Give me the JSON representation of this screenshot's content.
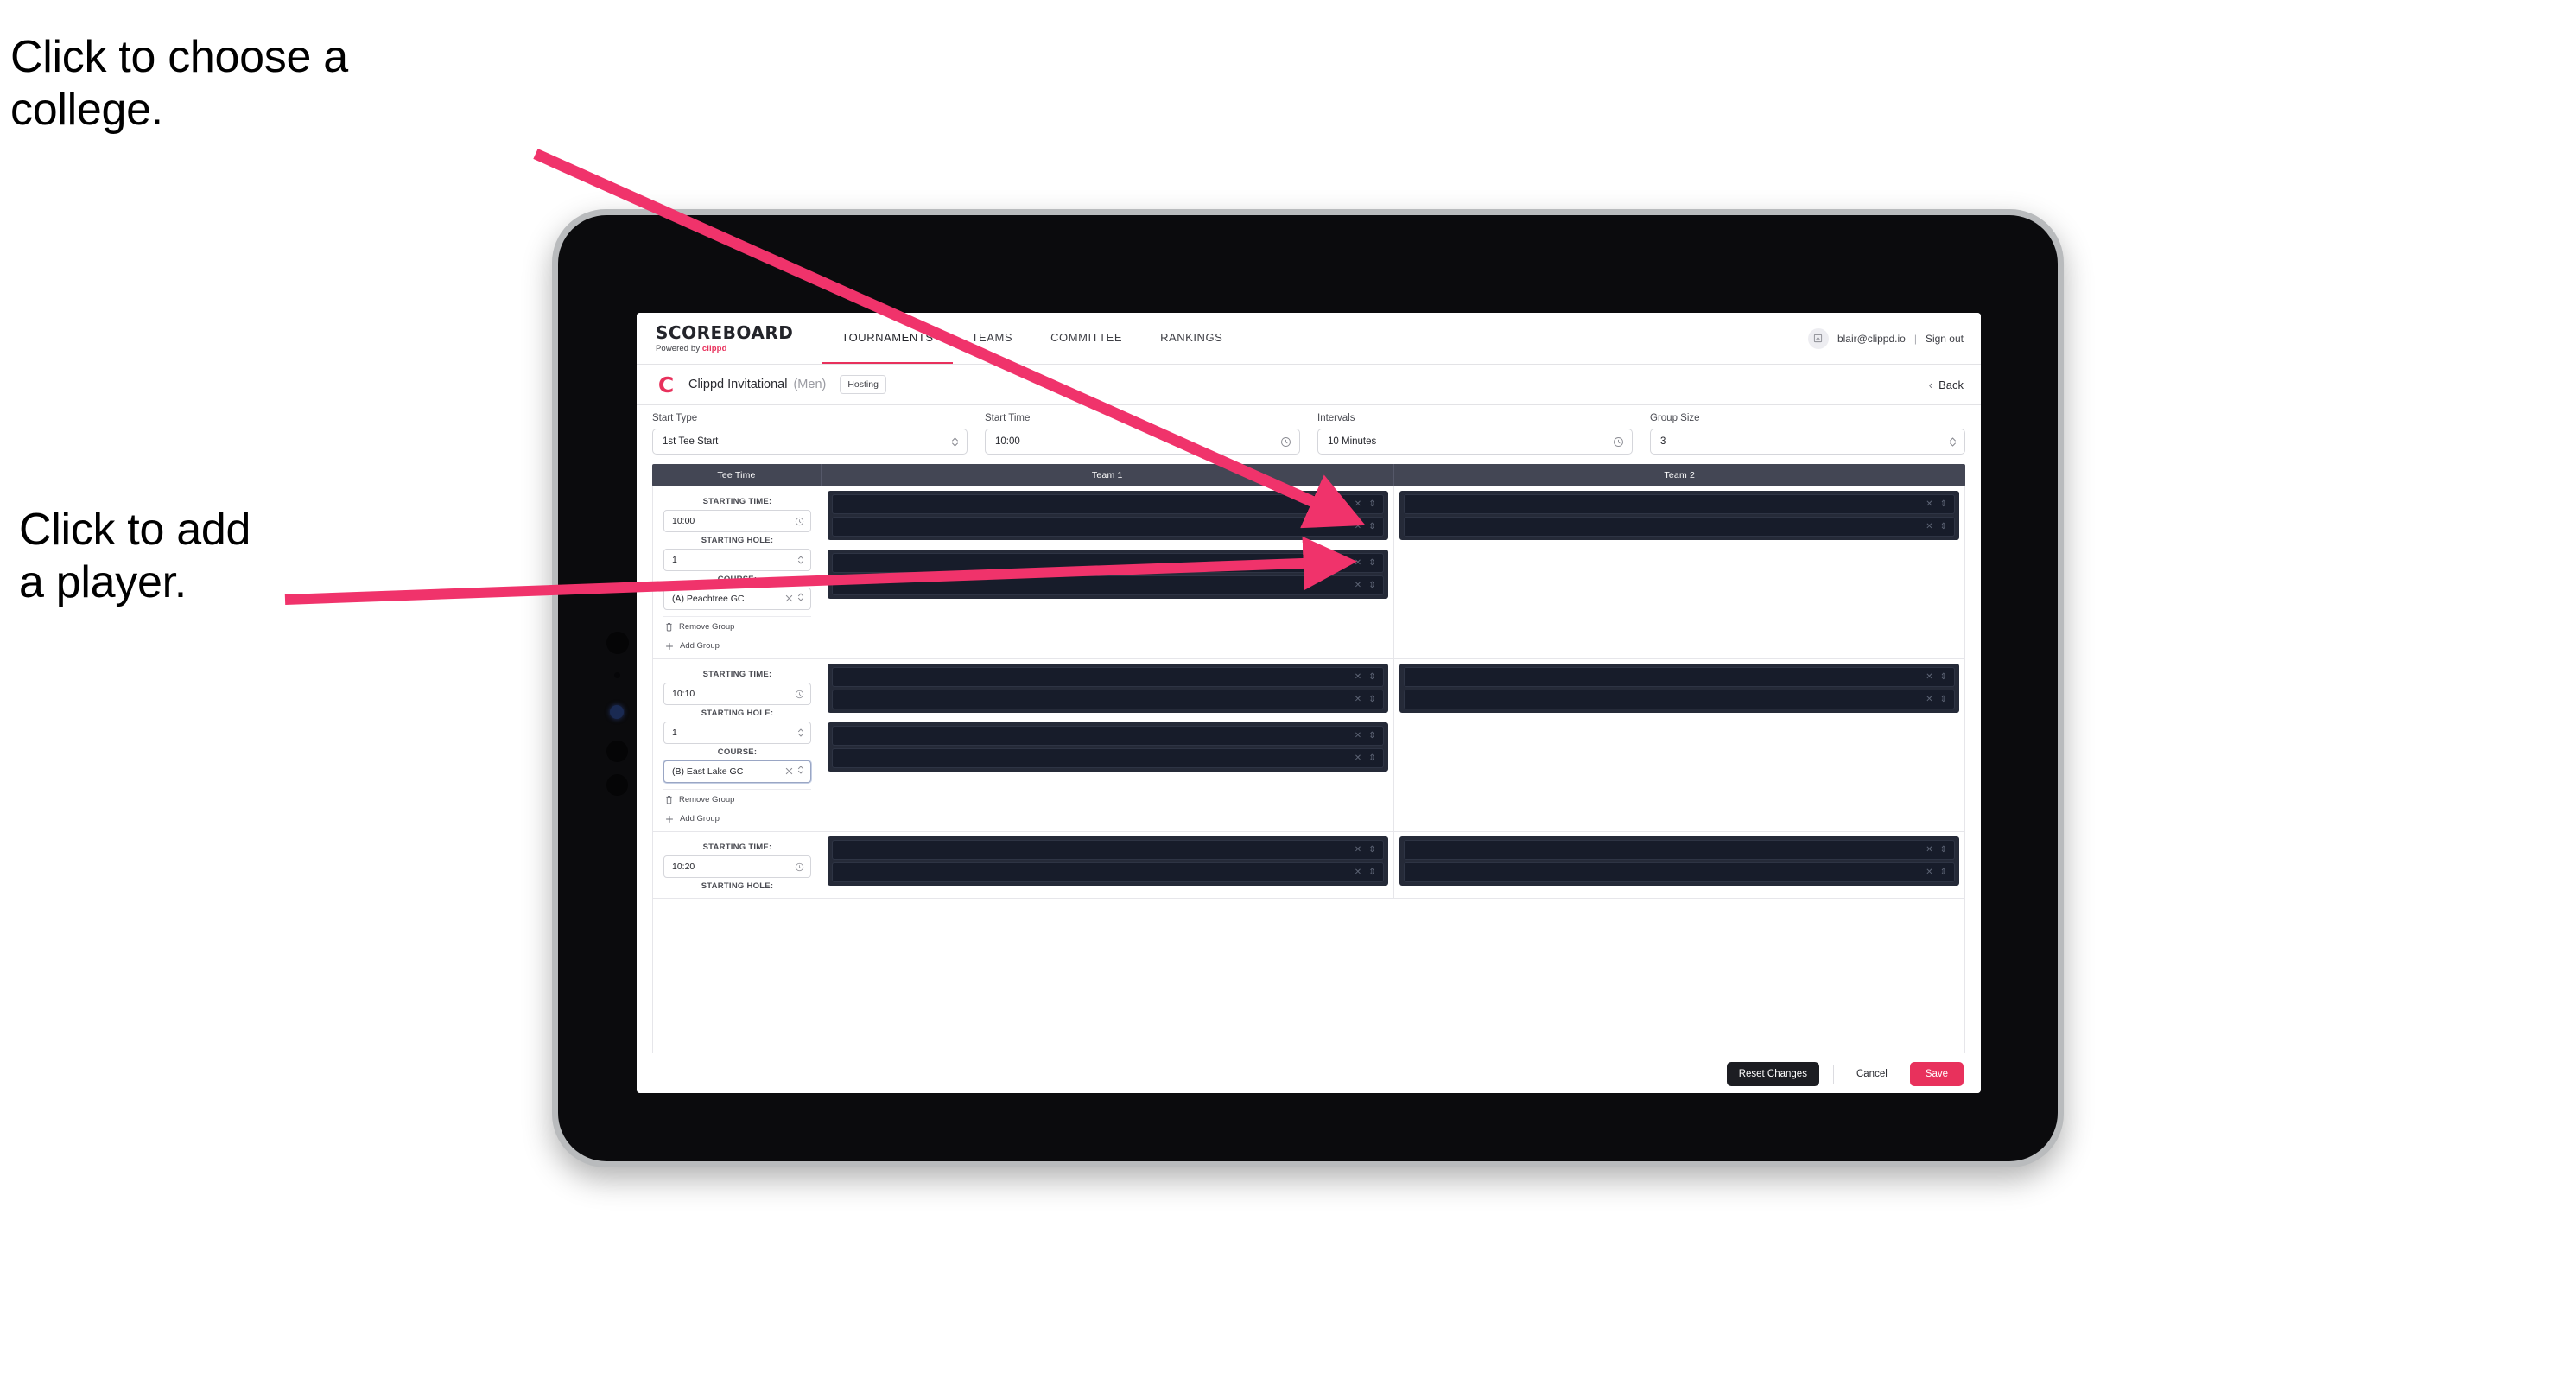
{
  "annotations": {
    "college": "Click to choose a\ncollege.",
    "player": "Click to add\na player."
  },
  "colors": {
    "accent_pink": "#e8315c",
    "table_header": "#434654",
    "player_block": "#252a38",
    "player_row": "#171c2a",
    "dark_button": "#1c1d22"
  },
  "header": {
    "brand_word": "SCOREBOARD",
    "brand_sub_prefix": "Powered by ",
    "brand_sub_name": "clippd",
    "tabs": [
      {
        "label": "TOURNAMENTS",
        "active": true
      },
      {
        "label": "TEAMS",
        "active": false
      },
      {
        "label": "COMMITTEE",
        "active": false
      },
      {
        "label": "RANKINGS",
        "active": false
      }
    ],
    "avatar_icon": "user-avatar-icon",
    "account_email": "blair@clippd.io",
    "separator": "|",
    "sign_out": "Sign out"
  },
  "tournament_bar": {
    "logo_letter": "C",
    "name": "Clippd Invitational",
    "gender": "(Men)",
    "badge": "Hosting",
    "back_chevron": "‹",
    "back_label": "Back"
  },
  "settings": [
    {
      "label": "Start Type",
      "value": "1st Tee Start",
      "icon": "chevron-updown-icon"
    },
    {
      "label": "Start Time",
      "value": "10:00",
      "icon": "clock-icon"
    },
    {
      "label": "Intervals",
      "value": "10 Minutes",
      "icon": "clock-icon"
    },
    {
      "label": "Group Size",
      "value": "3",
      "icon": "chevron-updown-icon"
    }
  ],
  "table": {
    "columns": [
      {
        "label": "Tee Time",
        "key": "tee"
      },
      {
        "label": "Team 1",
        "key": "team1"
      },
      {
        "label": "Team 2",
        "key": "team2"
      }
    ],
    "labels": {
      "starting_time": "STARTING TIME:",
      "starting_hole": "STARTING HOLE:",
      "course": "COURSE:",
      "remove_group": "Remove Group",
      "add_group": "Add Group"
    },
    "rows": [
      {
        "starting_time": "10:00",
        "starting_hole": "1",
        "course": "(A) Peachtree GC",
        "course_focused": false,
        "team1_groups": [
          {
            "players": [
              "",
              ""
            ]
          },
          {
            "players": [
              "",
              ""
            ]
          }
        ],
        "team2_groups": [
          {
            "players": [
              "",
              ""
            ]
          }
        ]
      },
      {
        "starting_time": "10:10",
        "starting_hole": "1",
        "course": "(B) East Lake GC",
        "course_focused": true,
        "team1_groups": [
          {
            "players": [
              "",
              ""
            ]
          },
          {
            "players": [
              "",
              ""
            ]
          }
        ],
        "team2_groups": [
          {
            "players": [
              "",
              ""
            ]
          }
        ]
      },
      {
        "starting_time": "10:20",
        "starting_hole": "",
        "course": "",
        "course_focused": false,
        "partial": true,
        "team1_groups": [
          {
            "players": [
              "",
              ""
            ]
          }
        ],
        "team2_groups": [
          {
            "players": [
              "",
              ""
            ]
          }
        ]
      }
    ]
  },
  "footer": {
    "reset_label": "Reset Changes",
    "cancel_label": "Cancel",
    "save_label": "Save"
  }
}
